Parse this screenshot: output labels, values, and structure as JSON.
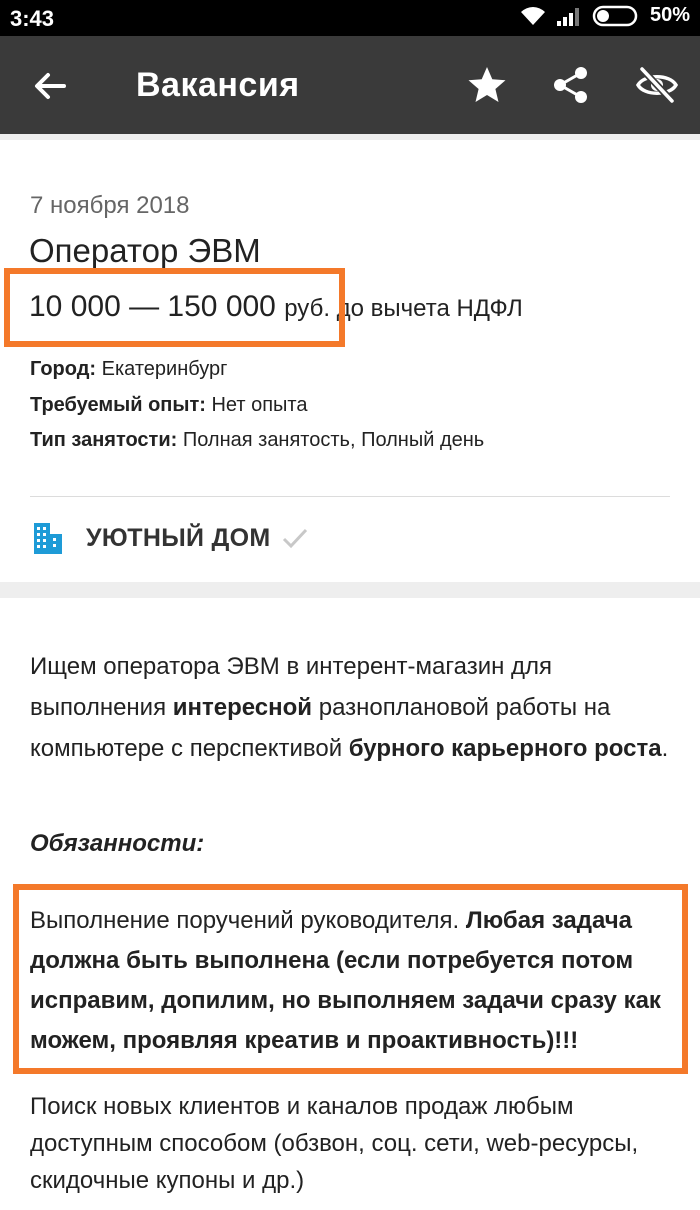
{
  "status_bar": {
    "time": "3:43",
    "battery_percent": "50%"
  },
  "app_bar": {
    "title": "Вакансия",
    "icons": [
      "back-arrow-icon",
      "star-icon",
      "share-icon",
      "hide-eye-icon"
    ]
  },
  "vacancy": {
    "date": "7 ноября 2018",
    "title": "Оператор ЭВМ",
    "salary_range": "10 000 — 150 000",
    "salary_currency": "руб.",
    "salary_note": " до вычета НДФЛ",
    "city_label": "Город:",
    "city_value": "Екатеринбург",
    "experience_label": "Требуемый опыт:",
    "experience_value": "Нет опыта",
    "employment_label": "Тип занятости:",
    "employment_value": "Полная занятость, Полный день"
  },
  "company": {
    "name": "УЮТНЫЙ ДОМ",
    "icon": "building-icon",
    "verified_icon": "check-icon"
  },
  "description": {
    "p1_a": "Ищем оператора ЭВМ в интерент-магазин для выполнения ",
    "p1_b": "интересной",
    "p1_c": " разноплановой работы на компьютере с перспективой ",
    "p1_d": "бурного карьерного роста",
    "p1_e": ".",
    "duties_heading": "Обязанности:",
    "duty1_a": "Выполнение поручений руководителя. ",
    "duty1_b": "Любая задача должна быть выполнена (если потребуется потом исправим, допилим, но выполняем задачи сразу как можем, проявляя креатив и проактивность)!!!",
    "duty2": "Поиск новых клиентов и каналов продаж любым доступным способом (обзвон, соц. сети, web-ресурсы, скидочные купоны и др.)"
  },
  "colors": {
    "app_bar": "#3a3a3a",
    "highlight": "#f4792a",
    "company_icon": "#1e9bd7"
  }
}
